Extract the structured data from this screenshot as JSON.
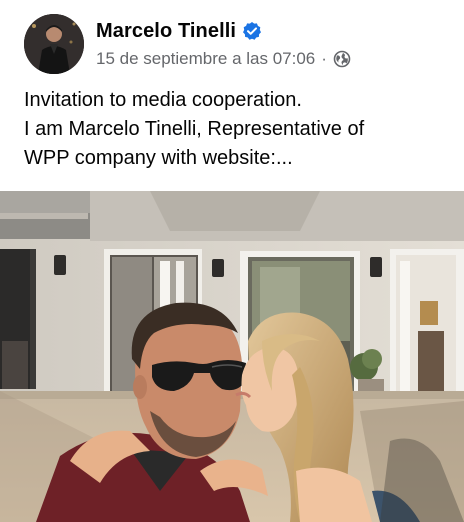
{
  "post": {
    "author": {
      "name": "Marcelo Tinelli",
      "verified": true,
      "avatar_icon": "profile-photo"
    },
    "meta": {
      "timestamp": "15 de septiembre a las 07:06",
      "separator": "·",
      "privacy_icon": "globe-icon"
    },
    "text": {
      "line1": "Invitation to media cooperation.",
      "line2": "I am Marcelo Tinelli, Representative of",
      "line3": "WPP company with website:..."
    },
    "photo": {
      "icon": "photo-of-couple-kissing"
    }
  },
  "colors": {
    "primary_text": "#050505",
    "secondary_text": "#65676b",
    "verified_badge": "#1b74e4",
    "background": "#ffffff"
  }
}
